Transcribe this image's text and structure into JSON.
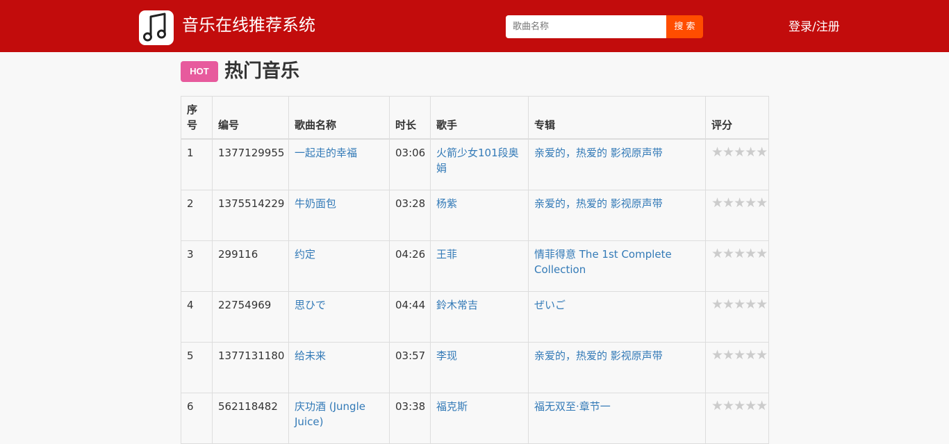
{
  "header": {
    "app_title": "音乐在线推荐系统",
    "logo_icon": "music-note-icon",
    "search_placeholder": "歌曲名称",
    "search_button": "搜 索",
    "login": "登录",
    "separator": "/",
    "register": "注册",
    "bar_color": "#c20c0c",
    "button_color": "#ff4d00"
  },
  "section": {
    "badge": "HOT",
    "badge_color": "#e75a9d",
    "title": "热门音乐"
  },
  "table": {
    "columns": [
      "序号",
      "编号",
      "歌曲名称",
      "时长",
      "歌手",
      "专辑",
      "评分"
    ],
    "rows": [
      {
        "index": "1",
        "id": "1377129955",
        "song": "一起走的幸福",
        "duration": "03:06",
        "artist": "火箭少女101段奥娟",
        "album": "亲爱的，热爱的 影视原声带",
        "rating": "★★★★★"
      },
      {
        "index": "2",
        "id": "1375514229",
        "song": "牛奶面包",
        "duration": "03:28",
        "artist": "杨紫",
        "album": "亲爱的，热爱的 影视原声带",
        "rating": "★★★★★"
      },
      {
        "index": "3",
        "id": "299116",
        "song": "约定",
        "duration": "04:26",
        "artist": "王菲",
        "album": "情菲得意 The 1st Complete Collection",
        "rating": "★★★★★"
      },
      {
        "index": "4",
        "id": "22754969",
        "song": "思ひで",
        "duration": "04:44",
        "artist": "鈴木常吉",
        "album": "ぜいご",
        "rating": "★★★★★"
      },
      {
        "index": "5",
        "id": "1377131180",
        "song": "给未来",
        "duration": "03:57",
        "artist": "李现",
        "album": "亲爱的，热爱的 影视原声带",
        "rating": "★★★★★"
      },
      {
        "index": "6",
        "id": "562118482",
        "song": "庆功酒 (Jungle Juice)",
        "duration": "03:38",
        "artist": "福克斯",
        "album": "福无双至·章节一",
        "rating": "★★★★★"
      }
    ],
    "link_color": "#337ab7",
    "star_color": "#cccccc"
  }
}
